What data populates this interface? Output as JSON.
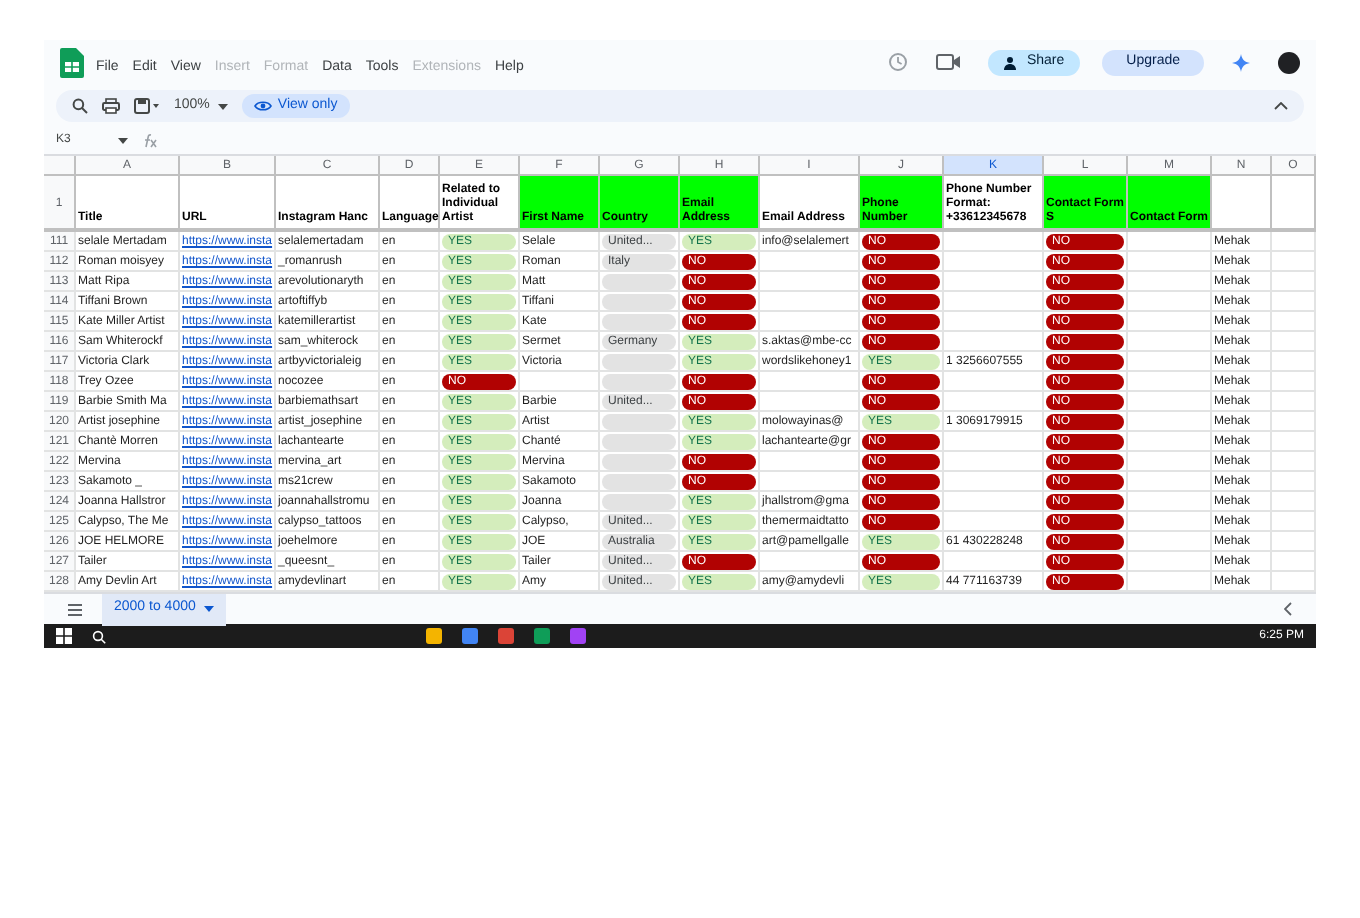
{
  "menu": [
    {
      "label": "File",
      "disabled": false
    },
    {
      "label": "Edit",
      "disabled": false
    },
    {
      "label": "View",
      "disabled": false
    },
    {
      "label": "Insert",
      "disabled": true
    },
    {
      "label": "Format",
      "disabled": true
    },
    {
      "label": "Data",
      "disabled": false
    },
    {
      "label": "Tools",
      "disabled": false
    },
    {
      "label": "Extensions",
      "disabled": true
    },
    {
      "label": "Help",
      "disabled": false
    }
  ],
  "share": "Share",
  "upgrade": "Upgrade",
  "toolbar": {
    "zoom": "100%",
    "view_mode": "View only"
  },
  "name_box": "K3",
  "columns": [
    {
      "letter": "A",
      "selected": false
    },
    {
      "letter": "B",
      "selected": false
    },
    {
      "letter": "C",
      "selected": false
    },
    {
      "letter": "D",
      "selected": false
    },
    {
      "letter": "E",
      "selected": false
    },
    {
      "letter": "F",
      "selected": false
    },
    {
      "letter": "G",
      "selected": false
    },
    {
      "letter": "H",
      "selected": false
    },
    {
      "letter": "I",
      "selected": false
    },
    {
      "letter": "J",
      "selected": false
    },
    {
      "letter": "K",
      "selected": true
    },
    {
      "letter": "L",
      "selected": false
    },
    {
      "letter": "M",
      "selected": false
    },
    {
      "letter": "N",
      "selected": false
    },
    {
      "letter": "O",
      "selected": false
    }
  ],
  "header_row": {
    "num": "1",
    "cells": [
      {
        "text": "Title",
        "highlighted": false
      },
      {
        "text": "URL",
        "highlighted": false
      },
      {
        "text": "Instagram Hanc",
        "highlighted": false
      },
      {
        "text": "Language",
        "highlighted": false
      },
      {
        "text": "Related to Individual Artist",
        "highlighted": false
      },
      {
        "text": "First Name",
        "highlighted": true
      },
      {
        "text": "Country",
        "highlighted": true
      },
      {
        "text": "Email Address",
        "highlighted": true
      },
      {
        "text": "Email Address",
        "highlighted": false
      },
      {
        "text": "Phone Number",
        "highlighted": true
      },
      {
        "text": "Phone Number Format: +33612345678",
        "highlighted": false
      },
      {
        "text": "Contact Form S",
        "highlighted": true
      },
      {
        "text": "Contact Form",
        "highlighted": true
      },
      {
        "highlighted": false
      },
      {
        "highlighted": false
      }
    ]
  },
  "rows": [
    {
      "num": "111",
      "title": "selale Mertadam",
      "url": "https://www.insta",
      "handle": "selalemertadam",
      "language": "en",
      "related": {
        "label": "YES",
        "positive": true
      },
      "first_name": "Selale",
      "country": "United...",
      "email_found": {
        "label": "YES",
        "positive": true
      },
      "email": "info@selalemert",
      "phone_found": {
        "label": "NO",
        "positive": false
      },
      "contact_form": {
        "label": "NO",
        "positive": false
      },
      "assignee": "Mehak"
    },
    {
      "num": "112",
      "title": "Roman moisyey",
      "url": "https://www.insta",
      "handle": "_romanrush",
      "language": "en",
      "related": {
        "label": "YES",
        "positive": true
      },
      "first_name": "Roman",
      "country": "Italy",
      "email_found": {
        "label": "NO",
        "positive": false
      },
      "phone_found": {
        "label": "NO",
        "positive": false
      },
      "contact_form": {
        "label": "NO",
        "positive": false
      },
      "assignee": "Mehak"
    },
    {
      "num": "113",
      "title": "Matt Ripa",
      "url": "https://www.insta",
      "handle": "arevolutionaryth",
      "language": "en",
      "related": {
        "label": "YES",
        "positive": true
      },
      "first_name": "Matt",
      "email_found": {
        "label": "NO",
        "positive": false
      },
      "phone_found": {
        "label": "NO",
        "positive": false
      },
      "contact_form": {
        "label": "NO",
        "positive": false
      },
      "assignee": "Mehak"
    },
    {
      "num": "114",
      "title": "Tiffani Brown",
      "url": "https://www.insta",
      "handle": "artoftiffyb",
      "language": "en",
      "related": {
        "label": "YES",
        "positive": true
      },
      "first_name": "Tiffani",
      "email_found": {
        "label": "NO",
        "positive": false
      },
      "phone_found": {
        "label": "NO",
        "positive": false
      },
      "contact_form": {
        "label": "NO",
        "positive": false
      },
      "assignee": "Mehak"
    },
    {
      "num": "115",
      "title": "Kate Miller Artist",
      "url": "https://www.insta",
      "handle": "katemillerartist",
      "language": "en",
      "related": {
        "label": "YES",
        "positive": true
      },
      "first_name": "Kate",
      "email_found": {
        "label": "NO",
        "positive": false
      },
      "phone_found": {
        "label": "NO",
        "positive": false
      },
      "contact_form": {
        "label": "NO",
        "positive": false
      },
      "assignee": "Mehak"
    },
    {
      "num": "116",
      "title": "Sam Whiterockf",
      "url": "https://www.insta",
      "handle": "sam_whiterock",
      "language": "en",
      "related": {
        "label": "YES",
        "positive": true
      },
      "first_name": "Sermet",
      "country": "Germany",
      "email_found": {
        "label": "YES",
        "positive": true
      },
      "email": "s.aktas@mbe-cc",
      "phone_found": {
        "label": "NO",
        "positive": false
      },
      "contact_form": {
        "label": "NO",
        "positive": false
      },
      "assignee": "Mehak"
    },
    {
      "num": "117",
      "title": "Victoria Clark",
      "url": "https://www.insta",
      "handle": "artbyvictorialeig",
      "language": "en",
      "related": {
        "label": "YES",
        "positive": true
      },
      "first_name": "Victoria",
      "email_found": {
        "label": "YES",
        "positive": true
      },
      "email": "wordslikehoney1",
      "phone_found": {
        "label": "YES",
        "positive": true
      },
      "phone": "1 3256607555",
      "contact_form": {
        "label": "NO",
        "positive": false
      },
      "assignee": "Mehak"
    },
    {
      "num": "118",
      "title": "Trey Ozee",
      "url": "https://www.insta",
      "handle": "nocozee",
      "language": "en",
      "related": {
        "label": "NO",
        "positive": false
      },
      "email_found": {
        "label": "NO",
        "positive": false
      },
      "phone_found": {
        "label": "NO",
        "positive": false
      },
      "contact_form": {
        "label": "NO",
        "positive": false
      },
      "assignee": "Mehak"
    },
    {
      "num": "119",
      "title": "Barbie Smith Ma",
      "url": "https://www.insta",
      "handle": "barbiemathsart",
      "language": "en",
      "related": {
        "label": "YES",
        "positive": true
      },
      "first_name": "Barbie",
      "country": "United...",
      "email_found": {
        "label": "NO",
        "positive": false
      },
      "phone_found": {
        "label": "NO",
        "positive": false
      },
      "contact_form": {
        "label": "NO",
        "positive": false
      },
      "assignee": "Mehak"
    },
    {
      "num": "120",
      "title": "Artist josephine",
      "url": "https://www.insta",
      "handle": "artist_josephine",
      "language": "en",
      "related": {
        "label": "YES",
        "positive": true
      },
      "first_name": "Artist",
      "email_found": {
        "label": "YES",
        "positive": true
      },
      "email": "molowayinas@",
      "phone_found": {
        "label": "YES",
        "positive": true
      },
      "phone": "1 3069179915",
      "contact_form": {
        "label": "NO",
        "positive": false
      },
      "assignee": "Mehak"
    },
    {
      "num": "121",
      "title": "Chantè Morren",
      "url": "https://www.insta",
      "handle": "lachantearte",
      "language": "en",
      "related": {
        "label": "YES",
        "positive": true
      },
      "first_name": "Chanté",
      "email_found": {
        "label": "YES",
        "positive": true
      },
      "email": "lachantearte@gr",
      "phone_found": {
        "label": "NO",
        "positive": false
      },
      "contact_form": {
        "label": "NO",
        "positive": false
      },
      "assignee": "Mehak"
    },
    {
      "num": "122",
      "title": "Mervina",
      "url": "https://www.insta",
      "handle": "mervina_art",
      "language": "en",
      "related": {
        "label": "YES",
        "positive": true
      },
      "first_name": "Mervina",
      "email_found": {
        "label": "NO",
        "positive": false
      },
      "phone_found": {
        "label": "NO",
        "positive": false
      },
      "contact_form": {
        "label": "NO",
        "positive": false
      },
      "assignee": "Mehak"
    },
    {
      "num": "123",
      "title": "Sakamoto _",
      "url": "https://www.insta",
      "handle": "ms21crew",
      "language": "en",
      "related": {
        "label": "YES",
        "positive": true
      },
      "first_name": "Sakamoto",
      "email_found": {
        "label": "NO",
        "positive": false
      },
      "phone_found": {
        "label": "NO",
        "positive": false
      },
      "contact_form": {
        "label": "NO",
        "positive": false
      },
      "assignee": "Mehak"
    },
    {
      "num": "124",
      "title": "Joanna Hallstror",
      "url": "https://www.insta",
      "handle": "joannahallstromu",
      "language": "en",
      "related": {
        "label": "YES",
        "positive": true
      },
      "first_name": "Joanna",
      "email_found": {
        "label": "YES",
        "positive": true
      },
      "email": "jhallstrom@gma",
      "phone_found": {
        "label": "NO",
        "positive": false
      },
      "contact_form": {
        "label": "NO",
        "positive": false
      },
      "assignee": "Mehak"
    },
    {
      "num": "125",
      "title": "Calypso, The Me",
      "url": "https://www.insta",
      "handle": "calypso_tattoos",
      "language": "en",
      "related": {
        "label": "YES",
        "positive": true
      },
      "first_name": "Calypso,",
      "country": "United...",
      "email_found": {
        "label": "YES",
        "positive": true
      },
      "email": "themermaidtatto",
      "phone_found": {
        "label": "NO",
        "positive": false
      },
      "contact_form": {
        "label": "NO",
        "positive": false
      },
      "assignee": "Mehak"
    },
    {
      "num": "126",
      "title": "JOE HELMORE",
      "url": "https://www.insta",
      "handle": "joehelmore",
      "language": "en",
      "related": {
        "label": "YES",
        "positive": true
      },
      "first_name": "JOE",
      "country": "Australia",
      "email_found": {
        "label": "YES",
        "positive": true
      },
      "email": "art@pamellgalle",
      "phone_found": {
        "label": "YES",
        "positive": true
      },
      "phone": "61 430228248",
      "contact_form": {
        "label": "NO",
        "positive": false
      },
      "assignee": "Mehak"
    },
    {
      "num": "127",
      "title": "Tailer",
      "url": "https://www.insta",
      "handle": "_queesnt_",
      "language": "en",
      "related": {
        "label": "YES",
        "positive": true
      },
      "first_name": "Tailer",
      "country": "United...",
      "email_found": {
        "label": "NO",
        "positive": false
      },
      "phone_found": {
        "label": "NO",
        "positive": false
      },
      "contact_form": {
        "label": "NO",
        "positive": false
      },
      "assignee": "Mehak"
    },
    {
      "num": "128",
      "title": "Amy Devlin Art",
      "url": "https://www.insta",
      "handle": "amydevlinart",
      "language": "en",
      "related": {
        "label": "YES",
        "positive": true
      },
      "first_name": "Amy",
      "country": "United...",
      "email_found": {
        "label": "YES",
        "positive": true
      },
      "email": "amy@amydevli",
      "phone_found": {
        "label": "YES",
        "positive": true
      },
      "phone": "44 771163739",
      "contact_form": {
        "label": "NO",
        "positive": false
      },
      "assignee": "Mehak"
    }
  ],
  "sheet_tab": {
    "label": "2000 to 4000",
    "selected": true
  },
  "taskbar": {
    "time": "6:25 PM"
  }
}
